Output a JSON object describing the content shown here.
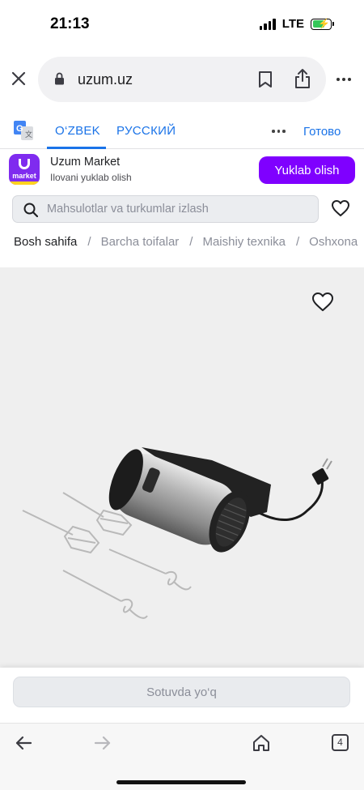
{
  "status": {
    "time": "21:13",
    "network": "LTE"
  },
  "browser": {
    "url": "uzum.uz"
  },
  "translate": {
    "active_lang": "O‘ZBEK",
    "other_lang": "РУССКИЙ",
    "done": "Готово"
  },
  "app_banner": {
    "name": "Uzum Market",
    "subtitle": "Ilovani yuklab olish",
    "button": "Yuklab olish",
    "logo_word": "market"
  },
  "search": {
    "placeholder": "Mahsulotlar va turkumlar izlash"
  },
  "breadcrumb": {
    "items": [
      "Bosh sahifa",
      "Barcha toifalar",
      "Maishiy texnika",
      "Oshxona"
    ],
    "separator": "/"
  },
  "product": {
    "status_button": "Sotuvda yo‘q"
  },
  "toolbar": {
    "tab_count": "4"
  },
  "colors": {
    "brand": "#7f00ff",
    "link": "#1a73e8",
    "muted": "#8b8e99"
  }
}
